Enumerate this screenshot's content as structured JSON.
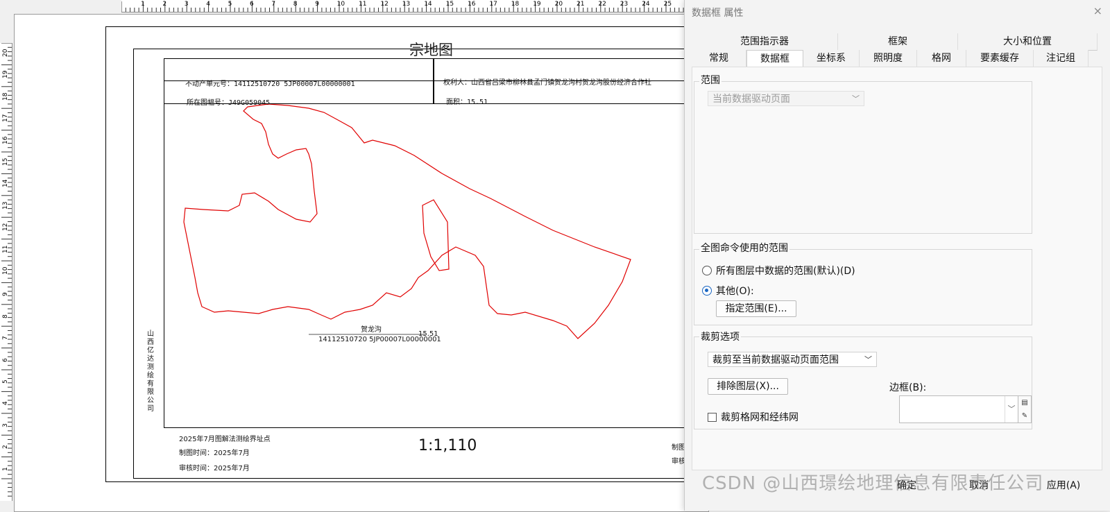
{
  "ruler": {
    "top": [
      "1",
      "2",
      "3",
      "4",
      "5",
      "6",
      "7",
      "8",
      "9",
      "10",
      "11",
      "12",
      "13",
      "14",
      "15",
      "16",
      "17",
      "18",
      "19",
      "20",
      "21",
      "22",
      "23",
      "24",
      "25"
    ],
    "left": [
      "20",
      "19",
      "18",
      "17",
      "16",
      "15",
      "14",
      "13",
      "12",
      "11",
      "10",
      "9",
      "8",
      "7",
      "6",
      "5",
      "4",
      "3",
      "2",
      "1"
    ]
  },
  "map": {
    "title": "宗地图",
    "unit_no": "不动产单元号：14112510720 5JP00007L00000001",
    "sheet_no": "所在图幅号：J49G059045",
    "right_holder": "权利人：山西省吕梁市柳林县孟门镇贺龙沟村贺龙沟股份经济合作社",
    "area": "面积：15.51",
    "parcel_name": "贺龙沟",
    "parcel_area": "15.51",
    "parcel_code": "14112510720 5JP00007L00000001",
    "company": "山西亿达测绘有限公司",
    "survey_note": "2025年7月图解法测绘界址点",
    "draw_time": "制图时间：2025年7月",
    "review_time": "审核时间：2025年7月",
    "draw_right": "制图",
    "review_right": "审核",
    "scale": "1:1,110"
  },
  "dialog": {
    "title": "数据框 属性",
    "close": "×",
    "tabs_top": [
      "范围指示器",
      "框架",
      "大小和位置"
    ],
    "tabs_bottom": [
      "常规",
      "数据框",
      "坐标系",
      "照明度",
      "格网",
      "要素缓存",
      "注记组"
    ],
    "extent_label": "范围",
    "extent_combo": "当前数据驱动页面",
    "full_extent_label": "全图命令使用的范围",
    "radio_all": "所有图层中数据的范围(默认)(D)",
    "radio_other": "其他(O):",
    "specify_btn": "指定范围(E)...",
    "clip_label": "裁剪选项",
    "clip_combo": "裁剪至当前数据驱动页面范围",
    "exclude_btn": "排除图层(X)...",
    "border_label": "边框(B):",
    "clip_grid_check": "裁剪格网和经纬网",
    "ok": "确定",
    "cancel": "取消",
    "apply": "应用(A)"
  },
  "watermark": "CSDN @山西璟绘地理信息有限责任公司",
  "colors": {
    "parcel": "#e00000",
    "accent": "#1a66c2"
  }
}
